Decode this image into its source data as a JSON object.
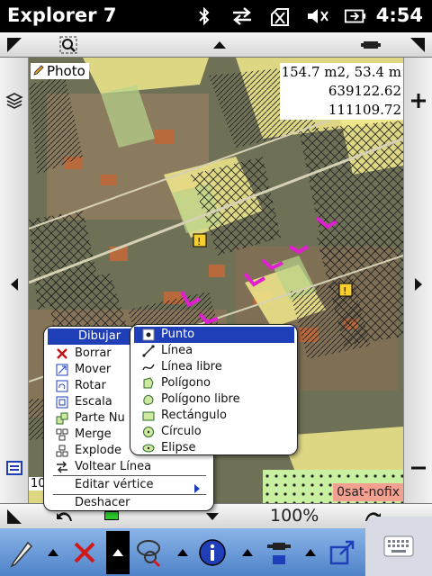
{
  "status": {
    "app_title": "Explorer 7",
    "time": "4:54",
    "icons": [
      "bluetooth-icon",
      "sync-icon",
      "no-signal-icon",
      "volume-icon",
      "battery-icon"
    ]
  },
  "map": {
    "photo_label": "Photo",
    "measure": [
      "154.7 m2, 53.4 m",
      "639122.62",
      "111109.72"
    ],
    "sat_label": "0sat-nofix",
    "scale_number": "10",
    "zoom": "100%"
  },
  "menu_main": {
    "header": "Dibujar",
    "items": [
      {
        "label": "Borrar",
        "icon": "delete-x-icon"
      },
      {
        "label": "Mover",
        "icon": "move-icon"
      },
      {
        "label": "Rotar",
        "icon": "rotate-icon"
      },
      {
        "label": "Escala",
        "icon": "scale-icon"
      },
      {
        "label": "Parte Nu",
        "icon": "new-part-icon"
      },
      {
        "label": "Merge",
        "icon": "merge-icon"
      },
      {
        "label": "Explode",
        "icon": "explode-icon"
      },
      {
        "label": "Voltear Línea",
        "icon": "flip-line-icon"
      },
      {
        "label": "Editar vértice",
        "icon": ""
      },
      {
        "label": "Deshacer",
        "icon": ""
      }
    ]
  },
  "menu_sub": {
    "items": [
      {
        "label": "Punto",
        "icon": "point-icon"
      },
      {
        "label": "Línea",
        "icon": "line-icon"
      },
      {
        "label": "Línea libre",
        "icon": "freehand-line-icon"
      },
      {
        "label": "Polígono",
        "icon": "polygon-icon"
      },
      {
        "label": "Polígono libre",
        "icon": "freehand-polygon-icon"
      },
      {
        "label": "Rectángulo",
        "icon": "rectangle-icon"
      },
      {
        "label": "Círculo",
        "icon": "circle-icon"
      },
      {
        "label": "Elipse",
        "icon": "ellipse-icon"
      }
    ]
  },
  "colors": {
    "menu_highlight": "#1f3fb8",
    "toolbar": "#5a8ed0",
    "parcel_yellow": "#f1e98c",
    "sketch_magenta": "#e020d0"
  }
}
